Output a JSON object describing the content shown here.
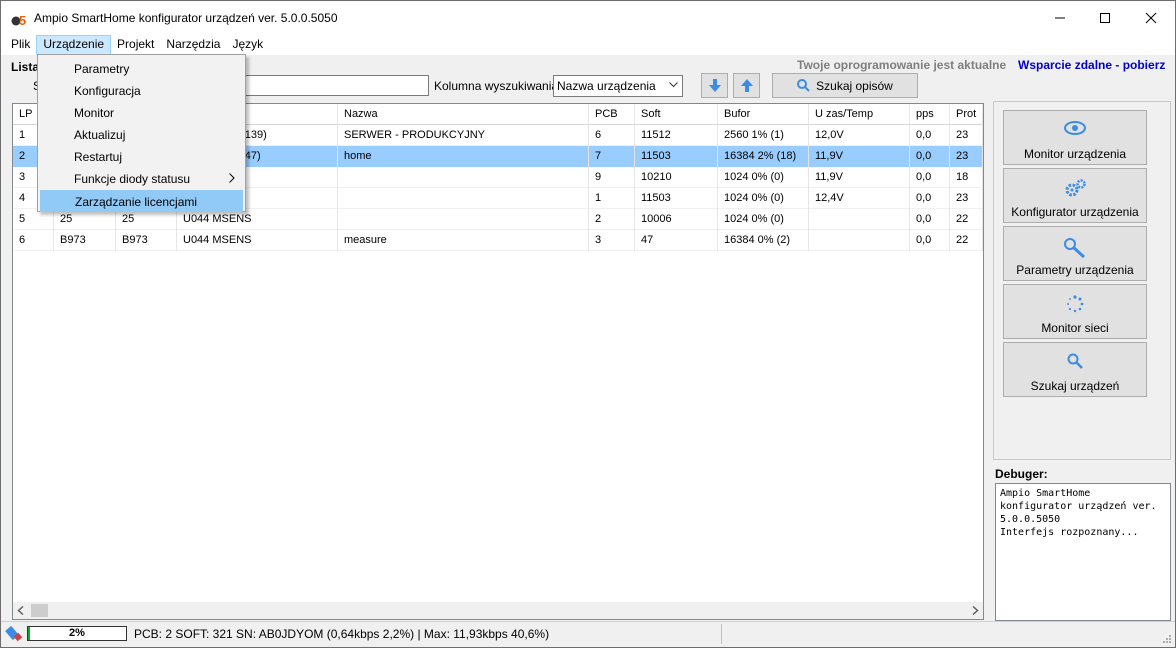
{
  "window": {
    "title": "Ampio SmartHome konfigurator urządzeń ver. 5.0.0.5050"
  },
  "menubar": [
    {
      "label": "Plik"
    },
    {
      "label": "Urządzenie"
    },
    {
      "label": "Projekt"
    },
    {
      "label": "Narzędzia"
    },
    {
      "label": "Język"
    }
  ],
  "device_menu": {
    "items": [
      {
        "label": "Parametry"
      },
      {
        "label": "Konfiguracja"
      },
      {
        "label": "Monitor"
      },
      {
        "label": "Aktualizuj"
      },
      {
        "label": "Restartuj"
      },
      {
        "label": "Funkcje diody statusu"
      },
      {
        "label": "Zarządzanie licencjami"
      }
    ],
    "highlighted": "Zarządzanie licencjami"
  },
  "toolbar": {
    "list_label": "Lista",
    "search_label": "S",
    "search_value": "",
    "column_label": "Kolumna wyszukiwania:",
    "column_value": "Nazwa urządzenia",
    "search_desc_button": "Szukaj opisów",
    "update_status": "Twoje oprogramowanie jest aktualne",
    "remote_support": "Wsparcie zdalne - pobierz"
  },
  "grid": {
    "columns": [
      "LP",
      "",
      "",
      "",
      "Nazwa",
      "PCB",
      "Soft",
      "Bufor",
      "U zas/Temp",
      "pps",
      "Prot"
    ],
    "rows": [
      [
        "1",
        "",
        "",
        "(192.168.77.139)",
        "SERWER - PRODUKCYJNY",
        "6",
        "11512",
        "2560 1% (1)",
        "12,0V",
        "0,0",
        "23"
      ],
      [
        "2",
        "",
        "",
        "(192.168.76.47)",
        "home",
        "7",
        "11503",
        "16384 2% (18)",
        "11,9V",
        "0,0",
        "23"
      ],
      [
        "3",
        "",
        "",
        "1",
        "",
        "9",
        "10210",
        "1024 0% (0)",
        "11,9V",
        "0,0",
        "18"
      ],
      [
        "4",
        "",
        "",
        "1s",
        "",
        "1",
        "11503",
        "1024 0% (0)",
        "12,4V",
        "0,0",
        "23"
      ],
      [
        "5",
        "25",
        "25",
        "U044 MSENS",
        "",
        "2",
        "10006",
        "1024 0% (0)",
        "",
        "0,0",
        "22"
      ],
      [
        "6",
        "B973",
        "B973",
        "U044 MSENS",
        "measure",
        "3",
        "47",
        "16384 0% (2)",
        "",
        "0,0",
        "22"
      ]
    ],
    "selected_row": 2
  },
  "side_buttons": [
    {
      "label": "Monitor urządzenia",
      "icon": "eye-icon"
    },
    {
      "label": "Konfigurator urządzenia",
      "icon": "gears-icon"
    },
    {
      "label": "Parametry urządzenia",
      "icon": "wrench-icon"
    },
    {
      "label": "Monitor sieci",
      "icon": "spinner-icon"
    },
    {
      "label": "Szukaj urządzeń",
      "icon": "search-icon"
    }
  ],
  "debugger": {
    "label": "Debuger:",
    "text": "Ampio SmartHome konfigurator urządzeń ver. 5.0.0.5050\nInterfejs rozpoznany..."
  },
  "statusbar": {
    "progress": "2%",
    "progress_fraction": 0.02,
    "text": "PCB: 2 SOFT: 321 SN: AB0JDYOM (0,64kbps 2,2%) | Max: 11,93kbps 40,6%)"
  },
  "colors": {
    "accent_blue": "#3c8ce6",
    "selection": "#99ccff",
    "menu_highlight": "#91c9f7",
    "link": "#0000cc",
    "progress_green": "#06b025"
  }
}
